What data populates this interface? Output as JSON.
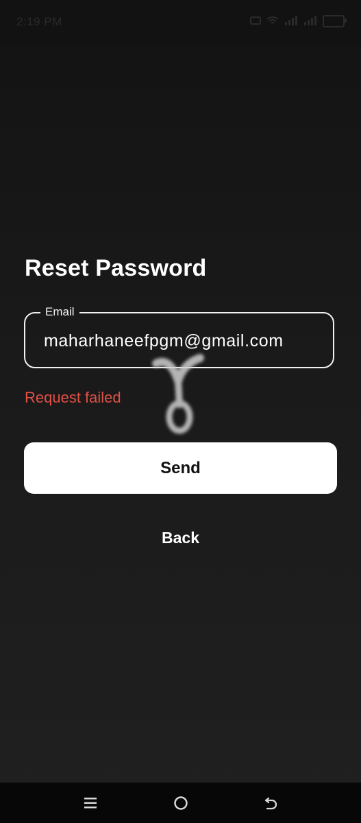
{
  "status_bar": {
    "time": "2:19 PM"
  },
  "screen": {
    "title": "Reset Password",
    "email": {
      "label": "Email",
      "value": "maharhaneefpgm@gmail.com"
    },
    "error": "Request failed",
    "send_label": "Send",
    "back_label": "Back"
  },
  "colors": {
    "background": "#1a1a1a",
    "primary_text": "#ffffff",
    "error": "#e05046",
    "button_bg": "#ffffff",
    "button_text": "#111111"
  },
  "icons": {
    "nav_menu": "menu-icon",
    "nav_home": "home-icon",
    "nav_back": "back-icon",
    "loading": "loading-icon"
  }
}
